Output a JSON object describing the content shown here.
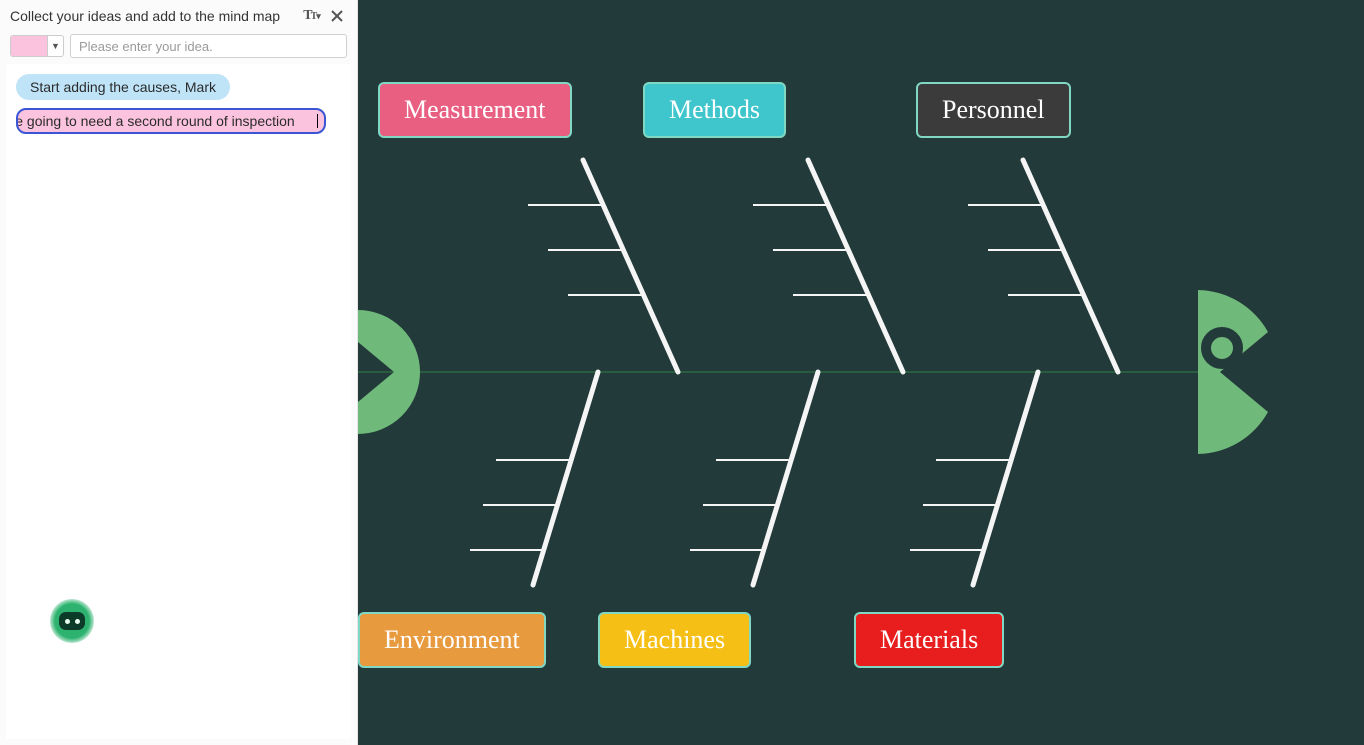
{
  "sidebar": {
    "title": "Collect your ideas and add to the mind map",
    "input_placeholder": "Please enter your idea.",
    "color_swatch": "#fbc3de",
    "items": [
      {
        "text": "Start adding the causes, Mark",
        "style": "blue",
        "editing": false
      },
      {
        "text": "These are going to need a second round of inspection",
        "style": "pink",
        "editing": true
      }
    ]
  },
  "diagram": {
    "type": "fishbone",
    "categories_top": [
      {
        "label": "Measurement",
        "bg": "#e85f82",
        "border": "#7fd7c4",
        "fg": "#ffffff"
      },
      {
        "label": "Methods",
        "bg": "#3fc6cc",
        "border": "#7fd7c4",
        "fg": "#ffffff"
      },
      {
        "label": "Personnel",
        "bg": "#3b3b3b",
        "border": "#7fd7c4",
        "fg": "#ffffff"
      }
    ],
    "categories_bottom": [
      {
        "label": "Environment",
        "bg": "#e89a3f",
        "border": "#7fd7c4",
        "fg": "#ffffff"
      },
      {
        "label": "Machines",
        "bg": "#f6bf15",
        "border": "#7fd7c4",
        "fg": "#ffffff"
      },
      {
        "label": "Materials",
        "bg": "#e81e1e",
        "border": "#7fd7c4",
        "fg": "#ffffff"
      }
    ],
    "spine_color": "#2a5d3f",
    "bone_color": "#f5f5f5",
    "fish_color": "#6fb97a",
    "branches_per_bone": 3
  }
}
